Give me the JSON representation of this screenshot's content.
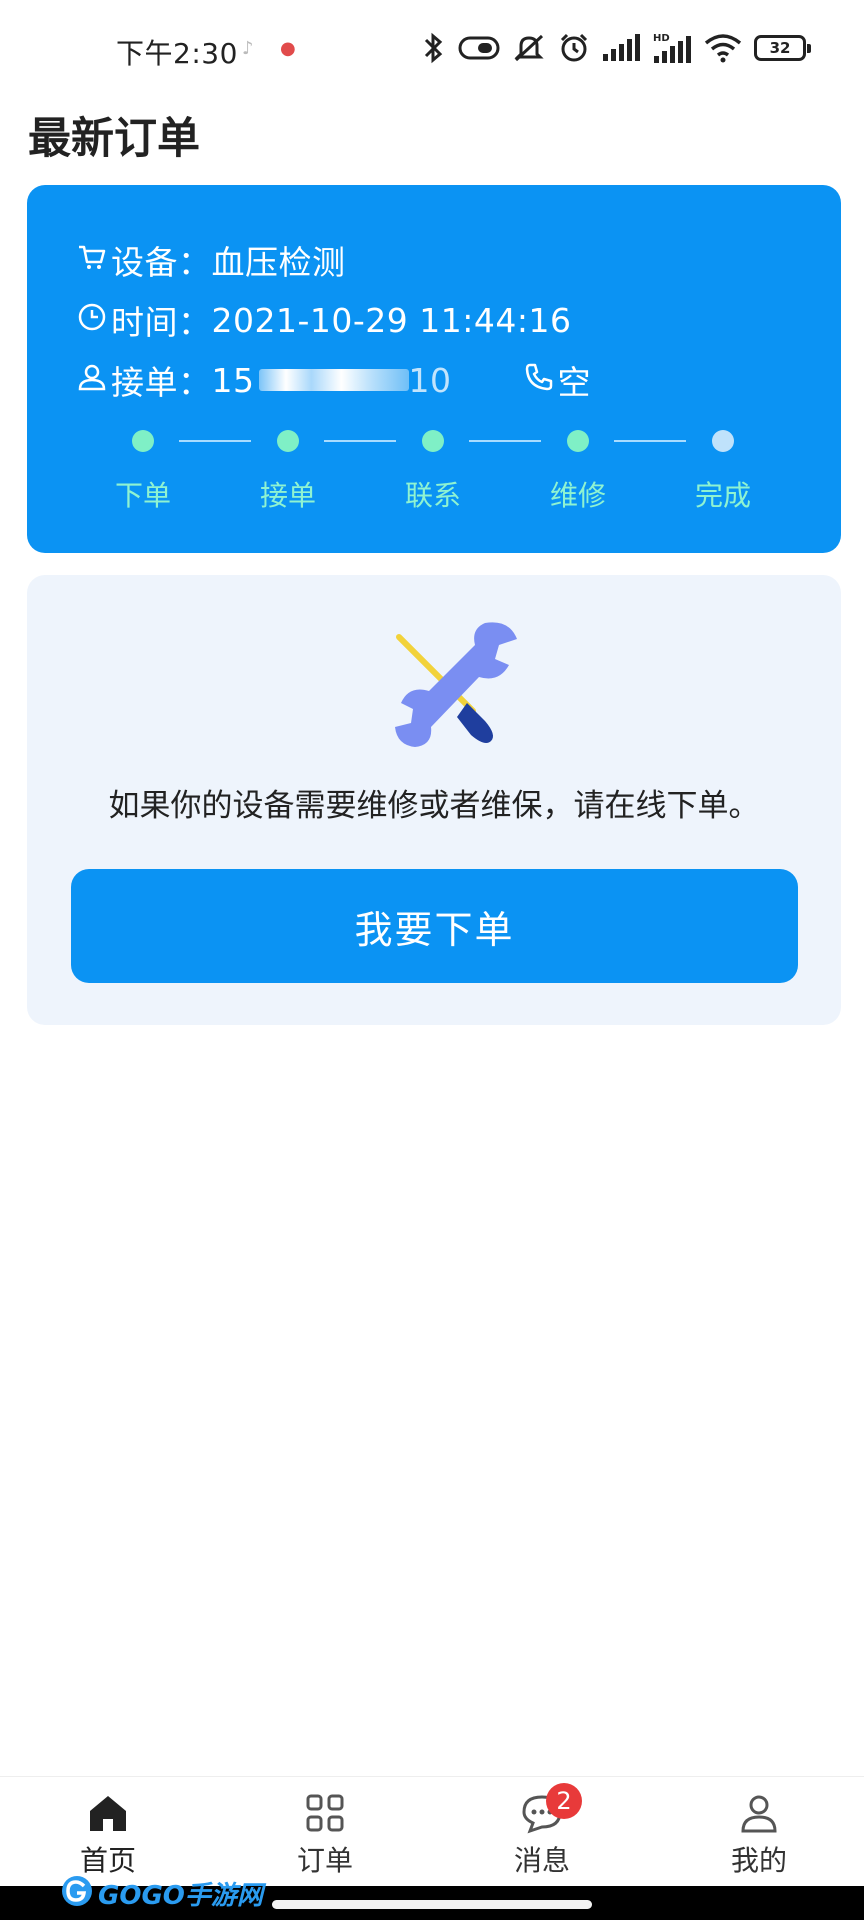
{
  "status_bar": {
    "time": "下午2:30",
    "battery": "32",
    "icons": [
      "bluetooth-icon",
      "toggle-icon",
      "mute-icon",
      "alarm-icon",
      "signal-icon",
      "hd-signal-icon",
      "wifi-icon",
      "battery-icon"
    ]
  },
  "page": {
    "title": "最新订单"
  },
  "order": {
    "device_label": "设备：",
    "device_value": "血压检测",
    "time_label": "时间：",
    "time_value": "2021-10-29 11:44:16",
    "taker_label": "接单：",
    "taker_prefix": "15",
    "taker_suffix": "10",
    "phone_value": "空",
    "steps": [
      "下单",
      "接单",
      "联系",
      "维修",
      "完成"
    ]
  },
  "service": {
    "description": "如果你的设备需要维修或者维保，请在线下单。",
    "button_label": "我要下单"
  },
  "nav": {
    "items": [
      {
        "label": "首页",
        "icon": "home-icon"
      },
      {
        "label": "订单",
        "icon": "grid-icon"
      },
      {
        "label": "消息",
        "icon": "message-icon",
        "badge": "2"
      },
      {
        "label": "我的",
        "icon": "user-icon"
      }
    ]
  },
  "watermark": {
    "text": "GOGO手游网"
  },
  "colors": {
    "primary": "#0b93f3",
    "step_done": "#7ff0c6",
    "step_pending": "#bfe2fb",
    "service_bg": "#eef4fc",
    "badge": "#e83a3a"
  }
}
